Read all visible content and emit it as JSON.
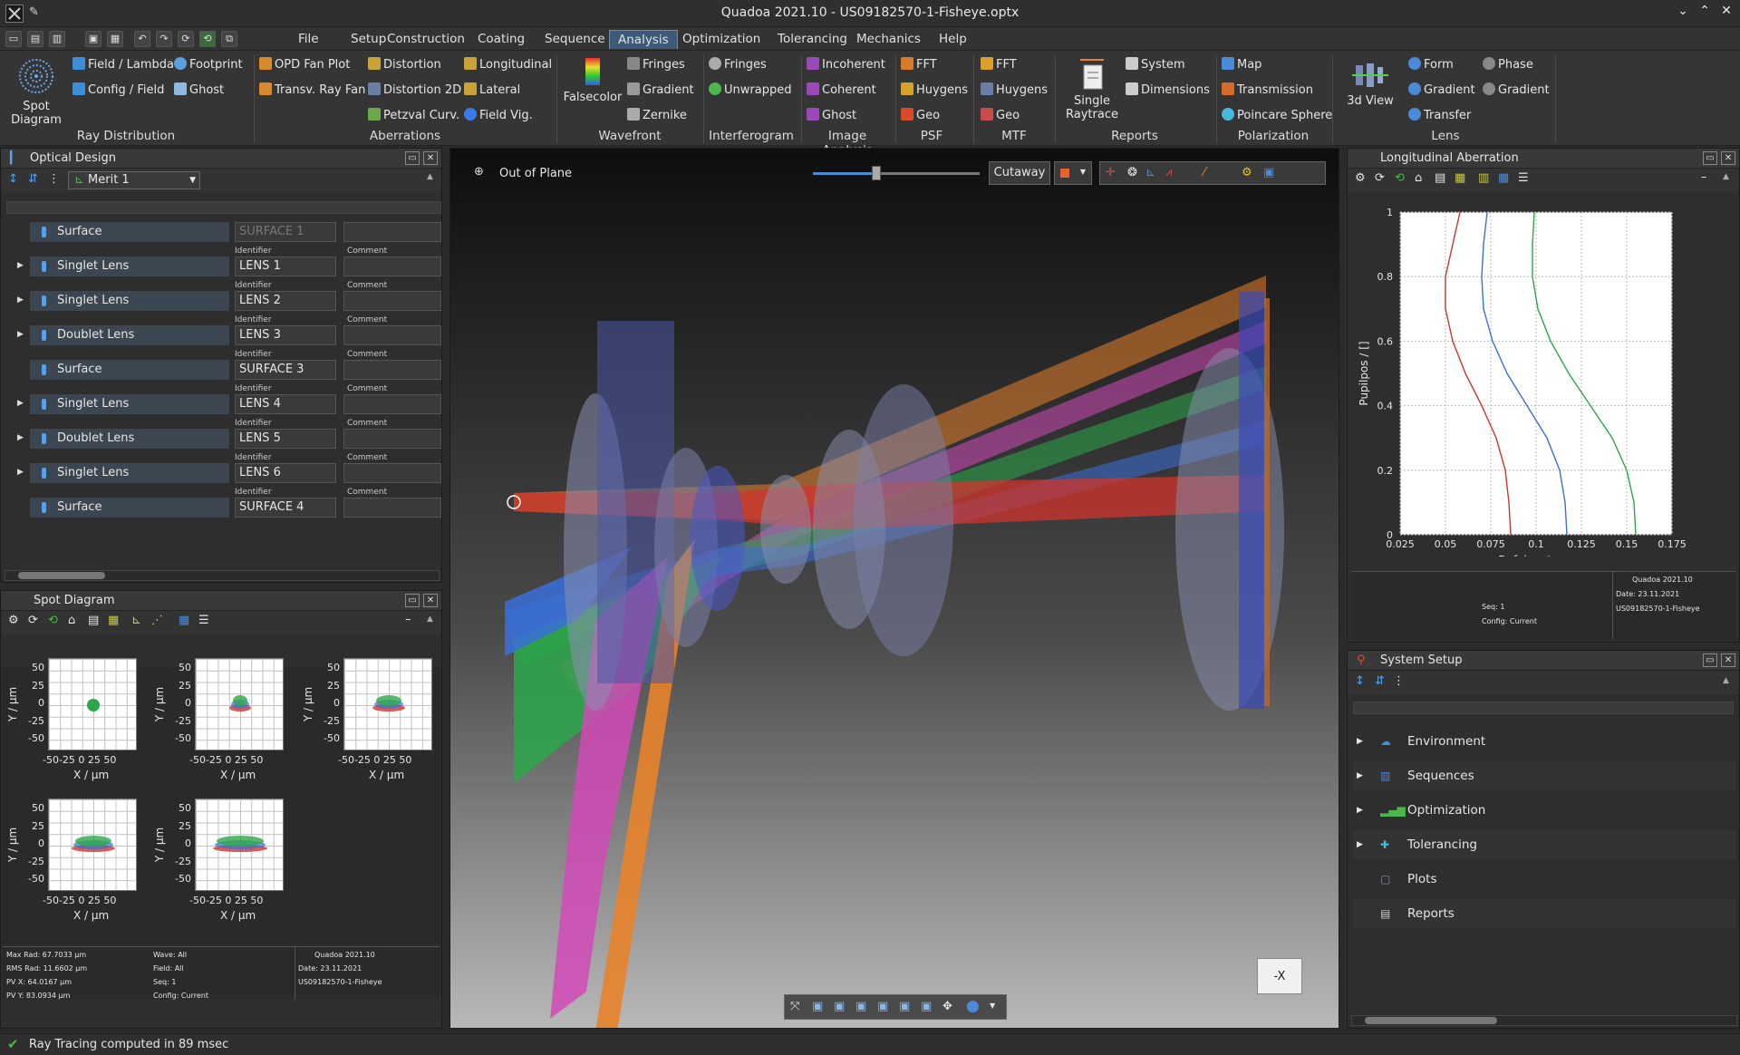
{
  "window": {
    "title": "Quadoa 2021.10 - US09182570-1-Fisheye.optx"
  },
  "menu": [
    "File",
    "Setup",
    "Construction",
    "Coating",
    "Sequence",
    "Analysis",
    "Optimization",
    "Tolerancing",
    "Mechanics",
    "Help"
  ],
  "ribbon": {
    "spot": {
      "label": "Spot Diagram"
    },
    "ray_distribution": {
      "group": "Ray Distribution",
      "items": [
        "Field / Lambda",
        "Config / Field",
        "Footprint",
        "Ghost"
      ]
    },
    "aberrations": {
      "group": "Aberrations",
      "items": [
        "OPD Fan Plot",
        "Transv. Ray Fan",
        "Distortion",
        "Distortion 2D",
        "Petzval Curv.",
        "Longitudinal",
        "Lateral",
        "Field Vig."
      ]
    },
    "wavefront": {
      "group": "Wavefront",
      "falsecolor": "Falsecolor",
      "items": [
        "Fringes",
        "Gradient",
        "Zernike"
      ]
    },
    "interferogram": {
      "group": "Interferogram",
      "items": [
        "Fringes",
        "Unwrapped"
      ]
    },
    "image_analysis": {
      "group": "Image Analysis",
      "items": [
        "Incoherent",
        "Coherent",
        "Ghost"
      ]
    },
    "psf": {
      "group": "PSF",
      "items": [
        "FFT",
        "Huygens",
        "Geo"
      ]
    },
    "mtf": {
      "group": "MTF",
      "items": [
        "FFT",
        "Huygens",
        "Geo"
      ]
    },
    "reports": {
      "group": "Reports",
      "single": "Single Raytrace",
      "items": [
        "System",
        "Dimensions"
      ]
    },
    "polarization": {
      "group": "Polarization",
      "items": [
        "Map",
        "Transmission",
        "Poincare Sphere"
      ]
    },
    "lens": {
      "group": "Lens",
      "view3d": "3d View",
      "items": [
        "Form",
        "Gradient",
        "Transfer",
        "Phase",
        "Gradient"
      ]
    }
  },
  "optical_design": {
    "title": "Optical Design",
    "merit": "Merit 1",
    "id_label": "Identifier",
    "comment_label": "Comment",
    "rows": [
      {
        "type": "Surface",
        "id": "SURFACE 1"
      },
      {
        "type": "Singlet Lens",
        "id": "LENS 1"
      },
      {
        "type": "Singlet Lens",
        "id": "LENS 2"
      },
      {
        "type": "Doublet Lens",
        "id": "LENS 3"
      },
      {
        "type": "Surface",
        "id": "SURFACE 3"
      },
      {
        "type": "Singlet Lens",
        "id": "LENS 4"
      },
      {
        "type": "Doublet Lens",
        "id": "LENS 5"
      },
      {
        "type": "Singlet Lens",
        "id": "LENS 6"
      },
      {
        "type": "Surface",
        "id": "SURFACE 4"
      }
    ]
  },
  "spot_diagram": {
    "title": "Spot Diagram",
    "ylabel": "Y / µm",
    "xlabel": "X / µm",
    "yticks": [
      "50",
      "25",
      "0",
      "-25",
      "-50"
    ],
    "xticks": "-50-25 0 25 50",
    "stats": {
      "max_rad": "Max Rad: 67.7033 µm",
      "rms_rad": "RMS Rad: 11.6602 µm",
      "pvx": "PV X: 64.0167 µm",
      "pvy": "PV Y: 83.0934 µm",
      "wave": "Wave: All",
      "field": "Field: All",
      "seq": "Seq: 1",
      "config": "Config: Current",
      "app": "Quadoa 2021.10",
      "date": "Date: 23.11.2021",
      "file": "US09182570-1-Fisheye"
    }
  },
  "viewport": {
    "mode": "Out of Plane",
    "cutaway": "Cutaway",
    "axis_label": "-X",
    "slider_pct": 0.38
  },
  "long_aberration": {
    "title": "Longitudinal Aberration",
    "chart_data": {
      "type": "line",
      "xlabel": "Defokus / mm",
      "ylabel": "Pupilpos / []",
      "xlim": [
        0.025,
        0.175
      ],
      "ylim": [
        0,
        1
      ],
      "xticks": [
        "0.025",
        "0.05",
        "0.075",
        "0.1",
        "0.125",
        "0.15",
        "0.175"
      ],
      "yticks": [
        "1",
        "0.8",
        "0.6",
        "0.4",
        "0.2",
        "0"
      ],
      "series": [
        {
          "color": "#d0342c",
          "x": [
            0.086,
            0.085,
            0.083,
            0.078,
            0.07,
            0.061,
            0.054,
            0.05,
            0.05,
            0.054,
            0.058
          ],
          "y": [
            0,
            0.1,
            0.2,
            0.3,
            0.4,
            0.5,
            0.6,
            0.7,
            0.8,
            0.9,
            1
          ]
        },
        {
          "color": "#3a6fd8",
          "x": [
            0.117,
            0.116,
            0.113,
            0.106,
            0.095,
            0.084,
            0.076,
            0.071,
            0.07,
            0.071,
            0.073
          ],
          "y": [
            0,
            0.1,
            0.2,
            0.3,
            0.4,
            0.5,
            0.6,
            0.7,
            0.8,
            0.9,
            1
          ]
        },
        {
          "color": "#2ca84a",
          "x": [
            0.155,
            0.154,
            0.15,
            0.142,
            0.13,
            0.118,
            0.108,
            0.101,
            0.098,
            0.098,
            0.099
          ],
          "y": [
            0,
            0.1,
            0.2,
            0.3,
            0.4,
            0.5,
            0.6,
            0.7,
            0.8,
            0.9,
            1
          ]
        }
      ]
    },
    "footer": {
      "seq": "Seq: 1",
      "config": "Config: Current",
      "app": "Quadoa 2021.10",
      "date": "Date: 23.11.2021",
      "file": "US09182570-1-Fisheye"
    }
  },
  "system_setup": {
    "title": "System Setup",
    "items": [
      "Environment",
      "Sequences",
      "Optimization",
      "Tolerancing",
      "Plots",
      "Reports"
    ]
  },
  "status": {
    "text": "Ray Tracing computed in 89 msec"
  }
}
